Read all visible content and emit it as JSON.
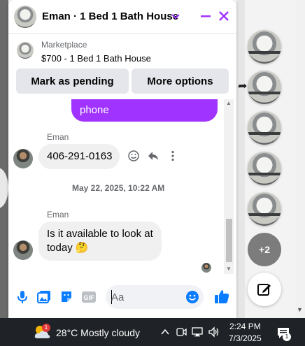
{
  "chat": {
    "title": "Eman · 1 Bed 1 Bath House",
    "marketplace_label": "Marketplace",
    "listing_title": "$700 - 1 Bed 1 Bath House",
    "actions": {
      "pending": "Mark as pending",
      "more": "More options"
    },
    "outgoing_fragment": "phone",
    "messages": [
      {
        "sender": "Eman",
        "text": "406-291-0163"
      },
      {
        "sender": "Eman",
        "text": "Is it available to look at today 🤔"
      }
    ],
    "timestamp": "May 22, 2025, 10:22 AM",
    "composer": {
      "placeholder": "Aa"
    },
    "accent_color": "#a033ff",
    "icon_color": "#0a7cff"
  },
  "chat_heads": {
    "more_count": "+2"
  },
  "taskbar": {
    "weather_badge": "1",
    "weather": "28°C  Mostly cloudy",
    "time": "2:24 PM",
    "date": "7/3/2025",
    "notification_count": "1"
  }
}
